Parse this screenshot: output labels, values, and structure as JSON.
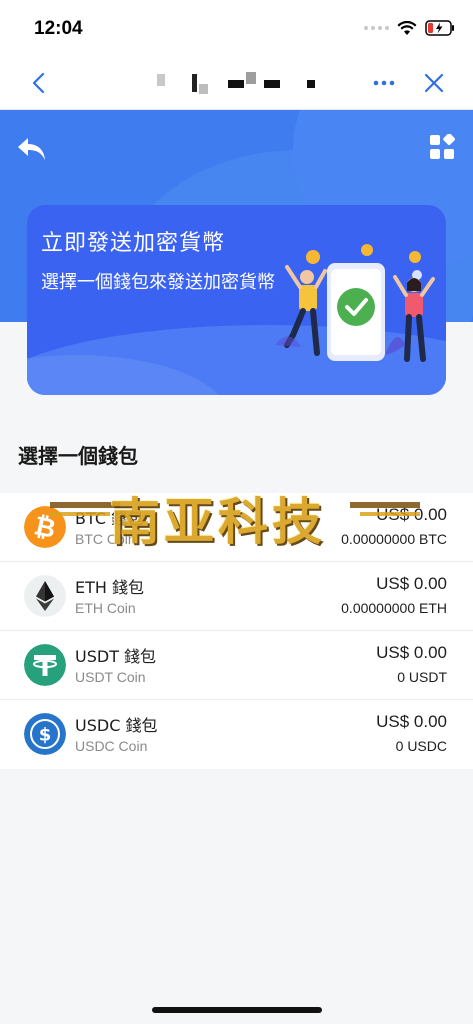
{
  "status_bar": {
    "time": "12:04"
  },
  "hero": {
    "banner_title": "立即發送加密貨幣",
    "banner_subtitle": "選擇一個錢包來發送加密貨幣"
  },
  "section_title": "選擇一個錢包",
  "wallets": [
    {
      "name": "BTC 錢包",
      "subtitle": "BTC Coin",
      "usd": "US$ 0.00",
      "amount": "0.00000000 BTC",
      "color": "#f7931a",
      "icon": "bitcoin-icon"
    },
    {
      "name": "ETH 錢包",
      "subtitle": "ETH Coin",
      "usd": "US$ 0.00",
      "amount": "0.00000000 ETH",
      "color": "#ecf0f1",
      "icon": "ethereum-icon"
    },
    {
      "name": "USDT 錢包",
      "subtitle": "USDT Coin",
      "usd": "US$ 0.00",
      "amount": "0 USDT",
      "color": "#26a17b",
      "icon": "tether-icon"
    },
    {
      "name": "USDC 錢包",
      "subtitle": "USDC Coin",
      "usd": "US$ 0.00",
      "amount": "0 USDC",
      "color": "#2775ca",
      "icon": "usdc-icon"
    }
  ],
  "watermark": {
    "text": "南亚科技"
  },
  "colors": {
    "accent": "#3e7cf0",
    "banner": "#3b63f2",
    "nav_icon": "#2f6fe4"
  }
}
